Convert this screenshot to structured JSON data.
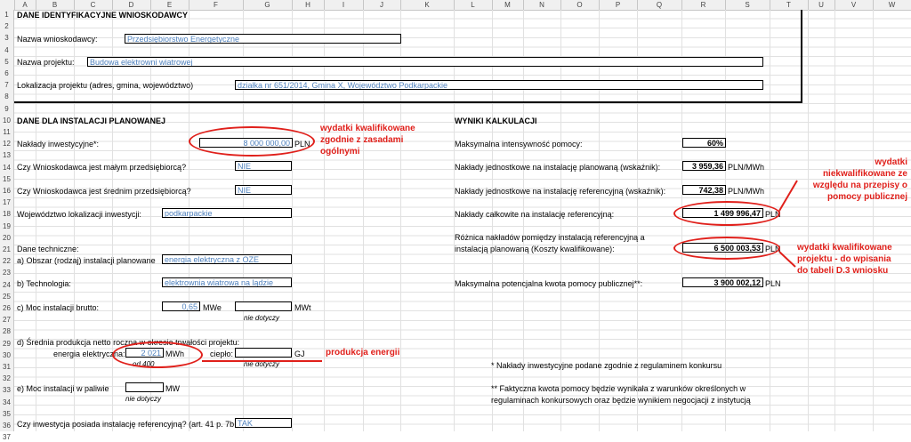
{
  "columns": [
    "A",
    "B",
    "C",
    "D",
    "E",
    "F",
    "G",
    "H",
    "I",
    "J",
    "K",
    "L",
    "M",
    "N",
    "O",
    "P",
    "Q",
    "R",
    "S",
    "T",
    "U",
    "V",
    "W"
  ],
  "rows": [
    "1",
    "2",
    "3",
    "4",
    "5",
    "6",
    "7",
    "8",
    "9",
    "10",
    "11",
    "12",
    "13",
    "14",
    "15",
    "16",
    "17",
    "18",
    "19",
    "20",
    "21",
    "22",
    "23",
    "24",
    "25",
    "26",
    "27",
    "28",
    "29",
    "30",
    "31",
    "32",
    "33",
    "34",
    "35",
    "36",
    "37"
  ],
  "section1": {
    "title": "DANE IDENTYFIKACYJNE WNIOSKODAWCY",
    "applicant_label": "Nazwa wnioskodawcy:",
    "applicant_value": "Przedsiębiorstwo Energetyczne",
    "project_label": "Nazwa projektu:",
    "project_value": "Budowa elektrowni wiatrowej",
    "location_label": "Lokalizacja projektu (adres, gmina, województwo)",
    "location_value": "działka nr 651/2014, Gmina X, Województwo Podkarpackie"
  },
  "section2": {
    "title": "DANE DLA INSTALACJI PLANOWANEJ",
    "invest_label": "Nakłady inwestycyjne*:",
    "invest_value": "8 000 000,00",
    "invest_unit": "PLN",
    "small_label": "Czy Wnioskodawca jest małym przedsiębiorcą?",
    "small_value": "NIE",
    "medium_label": "Czy Wnioskodawca jest średnim przedsiębiorcą?",
    "medium_value": "NIE",
    "voiv_label": "Województwo lokalizacji inwestycji:",
    "voiv_value": "podkarpackie",
    "tech_data_label": "Dane techniczne:",
    "area_label": "a) Obszar (rodzaj) instalacji planowane",
    "area_value": "energia elektryczna z OZE",
    "techn_label": "b) Technologia:",
    "techn_value": "elektrownia wiatrowa na lądzie",
    "power_label": "c) Moc instalacji brutto:",
    "power_value": "0,65",
    "power_unit": "MWe",
    "power2_unit": "MWt",
    "nie_dotyczy": "nie dotyczy",
    "avg_prod_label": "d) Średnia produkcja netto roczna w okresie trwałości projektu:",
    "el_energy_label": "energia elektryczna:",
    "el_energy_value": "2 021",
    "el_energy_unit": "MWh",
    "heat_label": "ciepło:",
    "heat_unit": "GJ",
    "od_400": "od 400",
    "fuel_power_label": "e) Moc instalacji w paliwie",
    "fuel_power_unit": "MW",
    "ref_question_label": "Czy inwestycja posiada instalację referencyjną? (art. 41 p. 7b",
    "ref_question_value": "TAK"
  },
  "results": {
    "title": "WYNIKI KALKULACJI",
    "max_intensity_label": "Maksymalna intensywność pomocy:",
    "max_intensity_value": "60%",
    "unit_planned_label": "Nakłady jednostkowe na instalację planowaną (wskaźnik):",
    "unit_planned_value": "3 959,36",
    "unit_planned_unit": "PLN/MWh",
    "unit_ref_label": "Nakłady jednostkowe na instalację referencyjną (wskaźnik):",
    "unit_ref_value": "742,38",
    "unit_ref_unit": "PLN/MWh",
    "total_ref_label": "Nakłady całkowite na instalację referencyjną:",
    "total_ref_value": "1 499 996,47",
    "total_ref_unit": "PLN",
    "diff_label_1": "Różnica nakładów pomiędzy instalacją referencyjną a",
    "diff_label_2": "instalacją planowaną (Koszty kwalifikowane):",
    "diff_value": "6 500 003,53",
    "diff_unit": "PLN",
    "max_aid_label": "Maksymalna potencjalna kwota pomocy publicznej**:",
    "max_aid_value": "3 900 002,12",
    "max_aid_unit": "PLN",
    "note1": "* Nakłady inwestycyjne podane zgodnie z regulaminem konkursu",
    "note2a": "** Faktyczna kwota pomocy będzie wynikała z warunków określonych w",
    "note2b": "regulaminach konkursowych oraz będzie wynikiem negocjacji z instytucją"
  },
  "annotations": {
    "a1_l1": "wydatki kwalifikowane",
    "a1_l2": "zgodnie z zasadami",
    "a1_l3": "ogólnymi",
    "a2_l1": "wydatki",
    "a2_l2": "niekwalifikowane ze",
    "a2_l3": "względu na przepisy o",
    "a2_l4": "pomocy publicznej",
    "a3_l1": "wydatki kwalifikowane",
    "a3_l2": "projektu - do wpisania",
    "a3_l3": "do tabeli D.3 wniosku",
    "a4": "produkcja energii",
    "color": "#e0201b"
  }
}
